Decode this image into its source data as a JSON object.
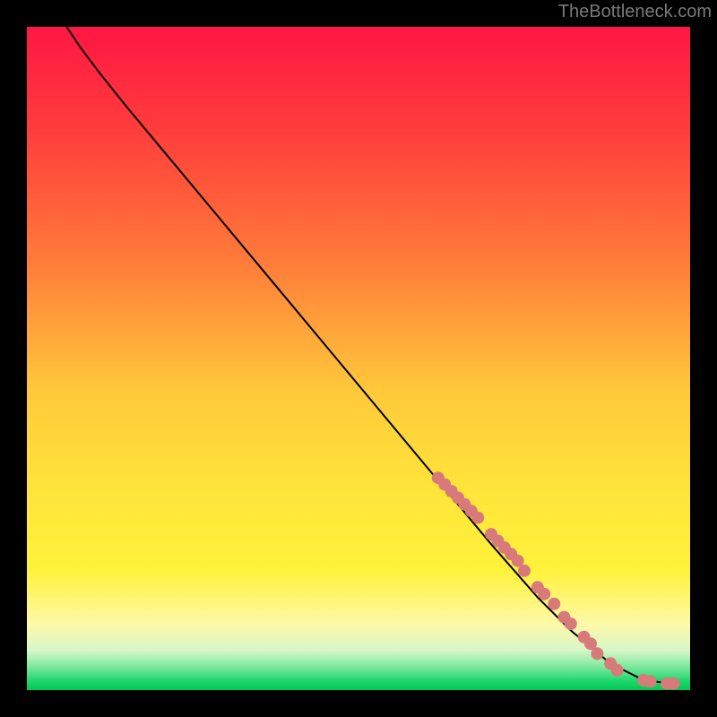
{
  "attribution": "TheBottleneck.com",
  "chart_data": {
    "type": "line",
    "title": "",
    "xlabel": "",
    "ylabel": "",
    "xlim": [
      0,
      100
    ],
    "ylim": [
      0,
      100
    ],
    "gradient_stops": [
      {
        "offset": 0.0,
        "color": "#ff1744"
      },
      {
        "offset": 0.15,
        "color": "#ff3b3b"
      },
      {
        "offset": 0.35,
        "color": "#ff7a3a"
      },
      {
        "offset": 0.55,
        "color": "#ffc93a"
      },
      {
        "offset": 0.7,
        "color": "#ffe53a"
      },
      {
        "offset": 0.82,
        "color": "#fff23a"
      },
      {
        "offset": 0.9,
        "color": "#fdf9a8"
      },
      {
        "offset": 0.94,
        "color": "#d8f7c8"
      },
      {
        "offset": 0.965,
        "color": "#7de89e"
      },
      {
        "offset": 0.985,
        "color": "#22d86f"
      },
      {
        "offset": 1.0,
        "color": "#00c853"
      }
    ],
    "curve": [
      {
        "x": 6,
        "y": 100
      },
      {
        "x": 8,
        "y": 97
      },
      {
        "x": 11,
        "y": 93
      },
      {
        "x": 15,
        "y": 88
      },
      {
        "x": 20,
        "y": 82
      },
      {
        "x": 30,
        "y": 70
      },
      {
        "x": 40,
        "y": 58
      },
      {
        "x": 50,
        "y": 46
      },
      {
        "x": 60,
        "y": 34
      },
      {
        "x": 70,
        "y": 22
      },
      {
        "x": 77,
        "y": 14
      },
      {
        "x": 82,
        "y": 9
      },
      {
        "x": 88,
        "y": 4
      },
      {
        "x": 93,
        "y": 1.5
      },
      {
        "x": 97,
        "y": 1
      }
    ],
    "series": [
      {
        "name": "markers",
        "color": "#d97a7a",
        "points": [
          {
            "x": 62,
            "y": 32
          },
          {
            "x": 63,
            "y": 31
          },
          {
            "x": 64,
            "y": 30
          },
          {
            "x": 65,
            "y": 29
          },
          {
            "x": 66,
            "y": 28
          },
          {
            "x": 67,
            "y": 27
          },
          {
            "x": 68,
            "y": 26
          },
          {
            "x": 70,
            "y": 23.5
          },
          {
            "x": 71,
            "y": 22.5
          },
          {
            "x": 72,
            "y": 21.5
          },
          {
            "x": 73,
            "y": 20.5
          },
          {
            "x": 74,
            "y": 19.5
          },
          {
            "x": 75,
            "y": 18
          },
          {
            "x": 77,
            "y": 15.5
          },
          {
            "x": 78,
            "y": 14.5
          },
          {
            "x": 79.5,
            "y": 13
          },
          {
            "x": 81,
            "y": 11
          },
          {
            "x": 82,
            "y": 10
          },
          {
            "x": 84,
            "y": 8
          },
          {
            "x": 85,
            "y": 7
          },
          {
            "x": 86,
            "y": 5.5
          },
          {
            "x": 88,
            "y": 4
          },
          {
            "x": 89,
            "y": 3
          },
          {
            "x": 93,
            "y": 1.5
          },
          {
            "x": 94,
            "y": 1.3
          },
          {
            "x": 96.5,
            "y": 1
          },
          {
            "x": 97.5,
            "y": 1
          }
        ]
      }
    ]
  }
}
